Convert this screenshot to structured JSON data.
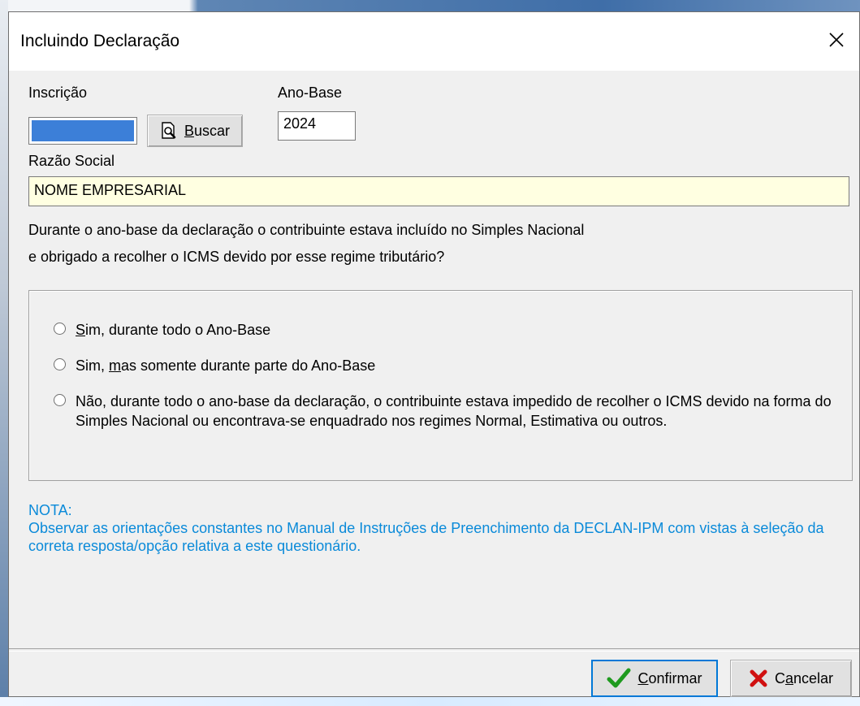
{
  "window": {
    "title": "Incluindo Declaração"
  },
  "form": {
    "inscricao_label": "Inscrição",
    "buscar_prefix": "",
    "buscar_mnemonic": "B",
    "buscar_rest": "uscar",
    "anobase_label": "Ano-Base",
    "anobase_value": "2024",
    "razao_label": "Razão Social",
    "razao_value": "NOME EMPRESARIAL"
  },
  "question": {
    "line1": "Durante o ano-base da declaração o contribuinte estava incluído no Simples Nacional",
    "line2": "e obrigado a recolher o ICMS devido por esse regime tributário?"
  },
  "options": [
    {
      "pre": "",
      "mnemonic": "S",
      "post": "im, durante todo o Ano-Base"
    },
    {
      "pre": "Sim, ",
      "mnemonic": "m",
      "post": "as somente durante parte do Ano-Base"
    },
    {
      "text": "Não, durante todo o ano-base da declaração, o contribuinte estava impedido de recolher o ICMS devido na forma do Simples Nacional ou encontrava-se enquadrado nos regimes Normal, Estimativa ou outros."
    }
  ],
  "note": {
    "heading": "NOTA:",
    "body": "Observar as orientações constantes no Manual de Instruções de Preenchimento da DECLAN-IPM com vistas à seleção da correta resposta/opção relativa a este questionário."
  },
  "buttons": {
    "confirmar_mnemonic": "C",
    "confirmar_rest": "onfirmar",
    "cancelar_pre": "C",
    "cancelar_mnemonic": "a",
    "cancelar_rest": "ncelar"
  },
  "colors": {
    "note_text": "#0a8ad9",
    "razao_bg": "#ffffe1",
    "confirm_check": "#1f9a1f",
    "cancel_x": "#d01010"
  }
}
